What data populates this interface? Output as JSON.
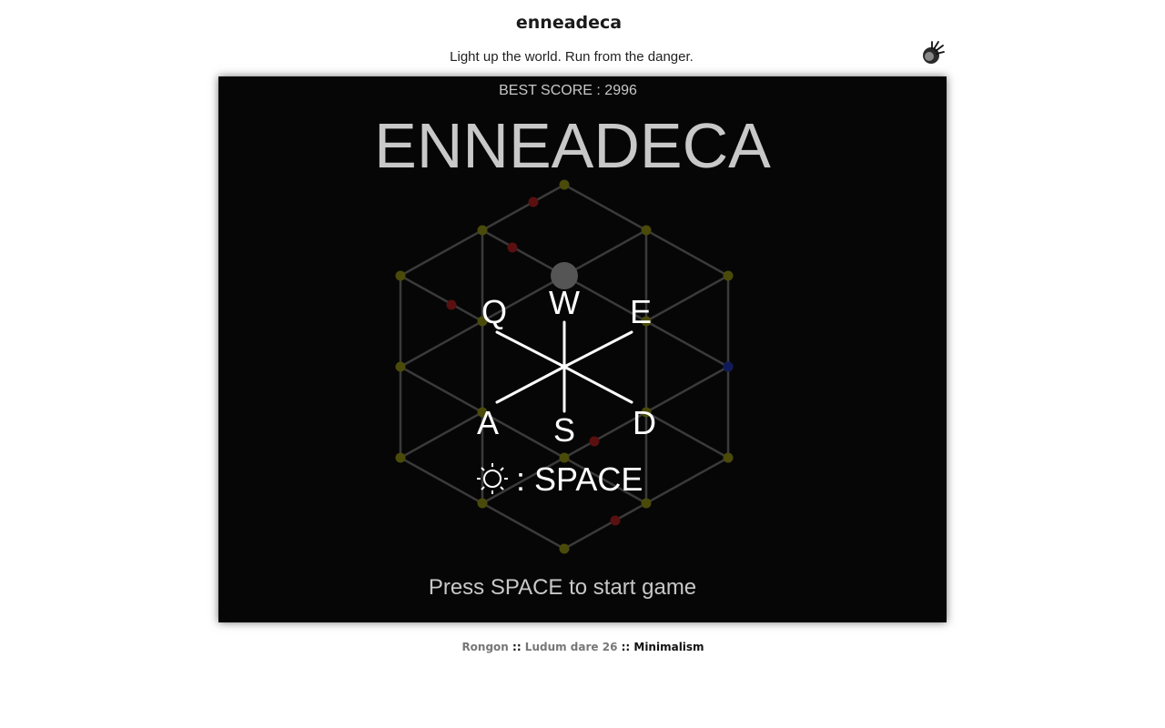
{
  "page": {
    "title": "enneadeca",
    "tagline": "Light up the world. Run from the danger.",
    "corner_icon": "bright-light-icon"
  },
  "game": {
    "best_score_label": "BEST SCORE : 2996",
    "logo": "ENNEADECA",
    "keys": {
      "q": "Q",
      "w": "W",
      "e": "E",
      "a": "A",
      "s": "S",
      "d": "D"
    },
    "space_hint": ": SPACE",
    "space_hint_icon": "sun-icon",
    "start_prompt": "Press SPACE to start game",
    "colors": {
      "background": "#060606",
      "edge": "#3a3a3a",
      "node_neutral": "#4a4a0a",
      "node_danger": "#5a1010",
      "node_goal": "#101a5a",
      "player": "#555555",
      "key_text": "#ffffff",
      "logo_text": "#c8c8c8"
    }
  },
  "footer": {
    "author": "Rongon",
    "sep1": " :: ",
    "event": "Ludum dare 26",
    "sep2": " :: ",
    "theme": "Minimalism"
  }
}
